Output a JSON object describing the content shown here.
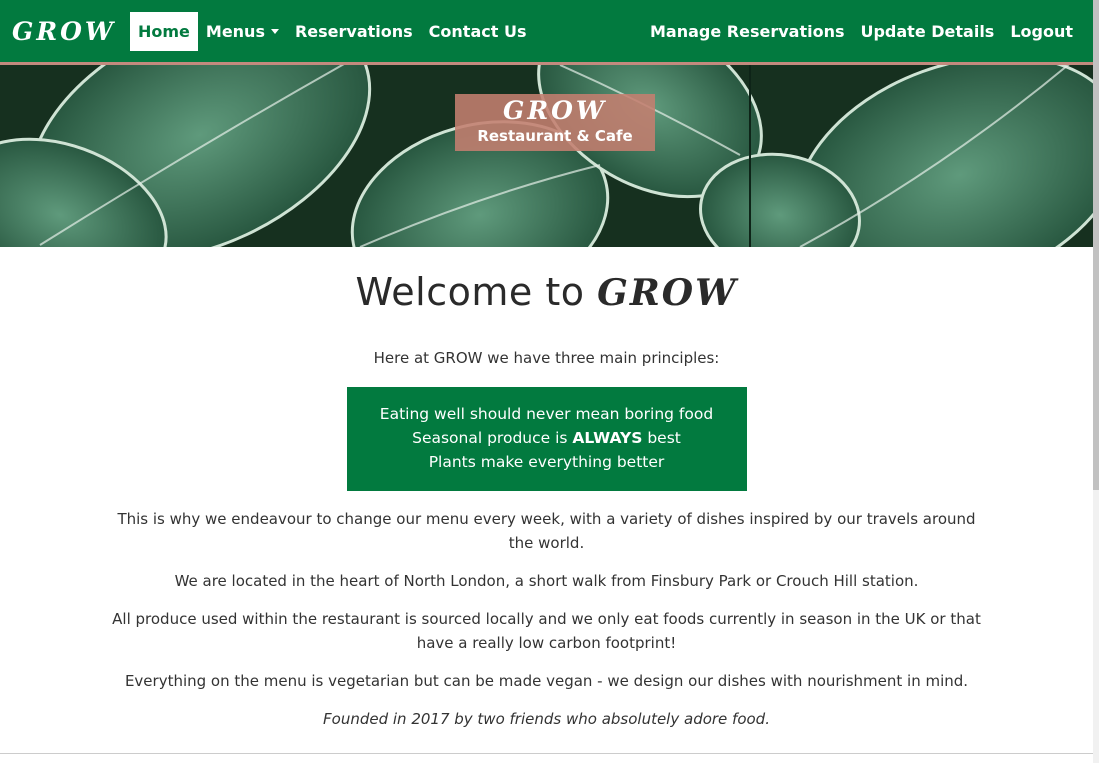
{
  "nav": {
    "brand": "GROW",
    "items": [
      {
        "label": "Home"
      },
      {
        "label": "Menus"
      },
      {
        "label": "Reservations"
      },
      {
        "label": "Contact Us"
      }
    ],
    "right_items": [
      {
        "label": "Manage Reservations"
      },
      {
        "label": "Update Details"
      },
      {
        "label": "Logout"
      }
    ]
  },
  "hero": {
    "title": "GROW",
    "subtitle": "Restaurant & Cafe"
  },
  "main": {
    "welcome_prefix": "Welcome to",
    "welcome_brand": "GROW",
    "intro": "Here at GROW we have three main principles:",
    "principles": {
      "line1": "Eating well should never mean boring food",
      "line2_pre": "Seasonal produce is",
      "line2_bold": "ALWAYS",
      "line2_post": "best",
      "line3": "Plants make everything better"
    },
    "paragraphs": [
      "This is why we endeavour to change our menu every week, with a variety of dishes inspired by our travels around the world.",
      "We are located in the heart of North London, a short walk from Finsbury Park or Crouch Hill station.",
      "All produce used within the restaurant is sourced locally and we only eat foods currently in season in the UK or that have a really low carbon footprint!",
      "Everything on the menu is vegetarian but can be made vegan - we design our dishes with nourishment in mind.",
      "Founded in 2017 by two friends who absolutely adore food."
    ]
  },
  "colors": {
    "primary": "#027a3f",
    "accent": "#c28a7e"
  }
}
